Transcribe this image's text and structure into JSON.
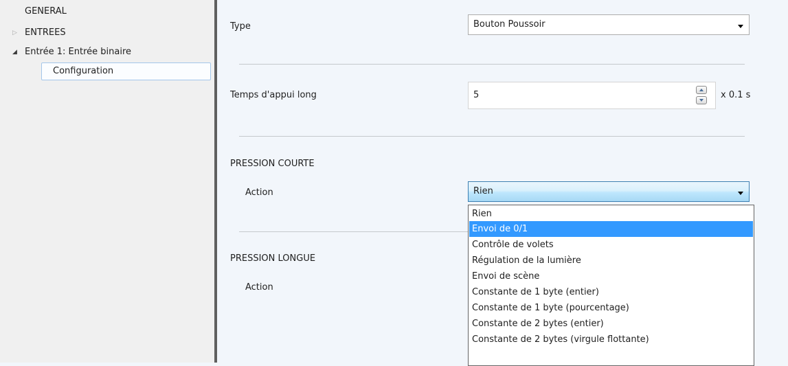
{
  "sidebar": {
    "items": [
      {
        "label": "GENERAL"
      },
      {
        "label": "ENTREES",
        "arrow": "▷"
      },
      {
        "label": "Entrée 1: Entrée binaire",
        "arrow": "◢"
      },
      {
        "label": "Configuration"
      }
    ]
  },
  "main": {
    "type_label": "Type",
    "type_value": "Bouton Poussoir",
    "long_press_label": "Temps d'appui long",
    "long_press_value": "5",
    "long_press_unit": "x 0.1 s",
    "short_section": "PRESSION COURTE",
    "short_action_label": "Action",
    "short_action_value": "Rien",
    "long_section": "PRESSION LONGUE",
    "long_action_label": "Action"
  },
  "dropdown": {
    "options": [
      "Rien",
      "Envoi de 0/1",
      "Contrôle de volets",
      "Régulation de la lumière",
      "Envoi de scène",
      "Constante de 1 byte (entier)",
      "Constante de 1 byte (pourcentage)",
      "Constante de 2 bytes (entier)",
      "Constante de 2 bytes (virgule flottante)"
    ],
    "highlighted_index": 1
  },
  "colors": {
    "highlight": "#3399ff",
    "sidebar_bg": "#f0f0f0",
    "panel_bg": "#f2f6fb",
    "divider": "#5f5f5f"
  },
  "icons": {
    "collapsed": "triangle-right-icon",
    "expanded": "triangle-down-right-icon",
    "combo": "chevron-down-icon",
    "spin_up": "spin-up-icon",
    "spin_down": "spin-down-icon"
  }
}
